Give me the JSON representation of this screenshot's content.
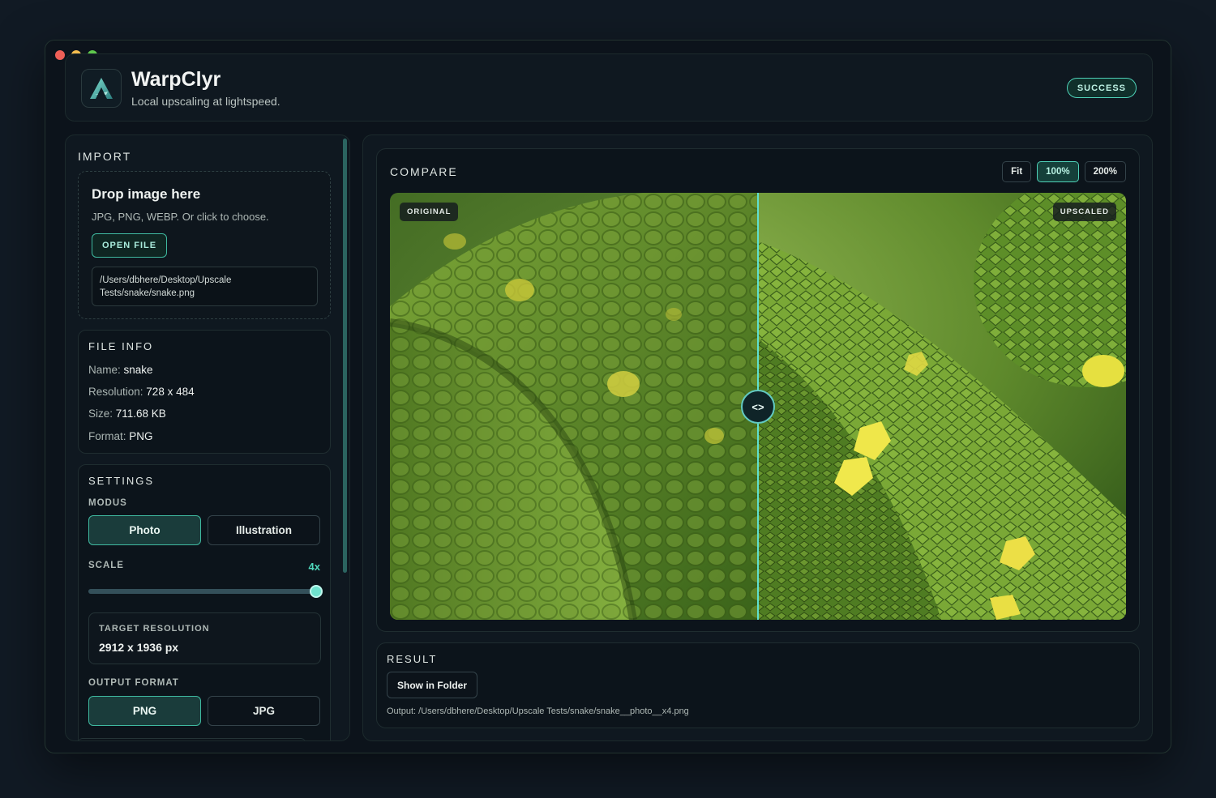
{
  "app": {
    "title": "WarpClyr",
    "subtitle": "Local upscaling at lightspeed.",
    "status": "SUCCESS",
    "accent_color": "#4fd1b8"
  },
  "import": {
    "section_title": "IMPORT",
    "drop_title": "Drop image here",
    "drop_subtitle": "JPG, PNG, WEBP. Or click to choose.",
    "open_button": "OPEN FILE",
    "file_path": "/Users/dbhere/Desktop/Upscale Tests/snake/snake.png"
  },
  "file_info": {
    "section_title": "FILE INFO",
    "rows": [
      {
        "label": "Name: ",
        "value": "snake"
      },
      {
        "label": "Resolution: ",
        "value": "728 x 484"
      },
      {
        "label": "Size: ",
        "value": "711.68 KB"
      },
      {
        "label": "Format: ",
        "value": "PNG"
      }
    ]
  },
  "settings": {
    "section_title": "SETTINGS",
    "modus_label": "MODUS",
    "modus_options": [
      "Photo",
      "Illustration"
    ],
    "modus_selected": "Photo",
    "scale_label": "SCALE",
    "scale_value": "4x",
    "scale_fraction": 1.0,
    "target_label": "TARGET RESOLUTION",
    "target_value": "2912 x 1936 px",
    "output_format_label": "OUTPUT FORMAT",
    "format_options": [
      "PNG",
      "JPG"
    ],
    "format_selected": "PNG"
  },
  "compare": {
    "section_title": "COMPARE",
    "zoom_options": [
      "Fit",
      "100%",
      "200%"
    ],
    "zoom_selected": "100%",
    "badge_left": "ORIGINAL",
    "badge_right": "UPSCALED",
    "divider_symbol": "<>",
    "divider_fraction": 0.5
  },
  "result": {
    "section_title": "RESULT",
    "show_button": "Show in Folder",
    "output_path": "Output: /Users/dbhere/Desktop/Upscale Tests/snake/snake__photo__x4.png"
  }
}
